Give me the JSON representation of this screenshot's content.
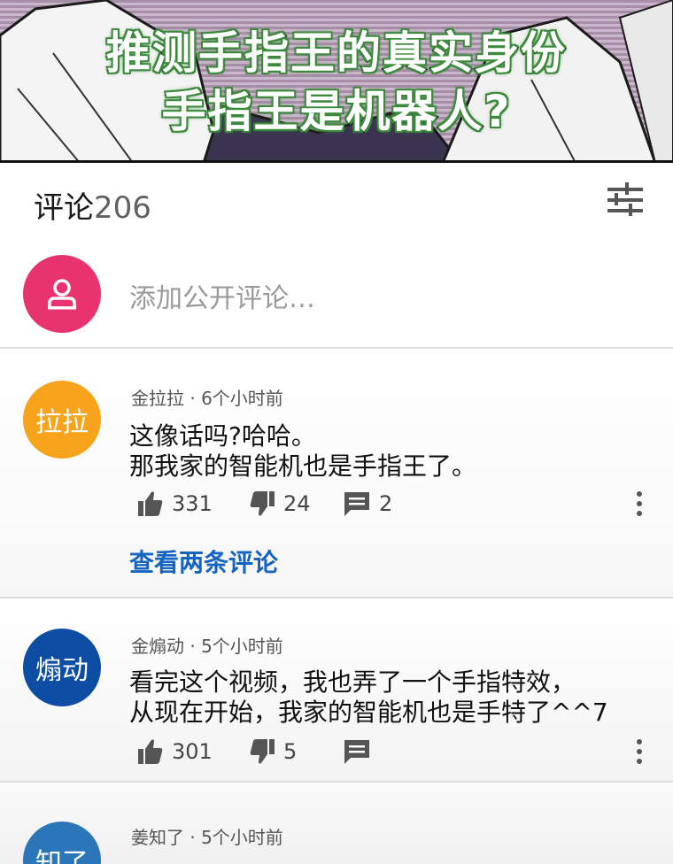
{
  "banner": {
    "caption_line1": "推测手指王的真实身份",
    "caption_line2": "手指王是机器人?"
  },
  "comments_header": {
    "title": "评论",
    "count": "206",
    "filter_icon": "sliders-icon"
  },
  "add_comment": {
    "placeholder": "添加公开评论…",
    "avatar_icon": "person-icon",
    "avatar_color": "#e8336f"
  },
  "comments": [
    {
      "avatar_text": "拉拉",
      "avatar_color": "#f7a31c",
      "author": "金拉拉",
      "time": "· 6个小时前",
      "text": "这像话吗?哈哈。\n那我家的智能机也是手指王了。",
      "likes": "331",
      "dislikes": "24",
      "replies": "2",
      "view_replies": "查看两条评论"
    },
    {
      "avatar_text": "煽动",
      "avatar_color": "#0d4da3",
      "author": "金煽动",
      "time": "· 5个小时前",
      "text": "看完这个视频，我也弄了一个手指特效，\n从现在开始，我家的智能机也是手特了^^7",
      "likes": "301",
      "dislikes": "5"
    },
    {
      "avatar_text": "知了",
      "avatar_color": "#2b76b9",
      "author": "姜知了",
      "time": "· 5个小时前"
    }
  ],
  "icons": {
    "like": "thumbs-up-icon",
    "dislike": "thumbs-down-icon",
    "reply": "comment-icon",
    "more": "more-vertical-icon"
  },
  "colors": {
    "link": "#1565c0",
    "divider": "#dcdcdc"
  }
}
